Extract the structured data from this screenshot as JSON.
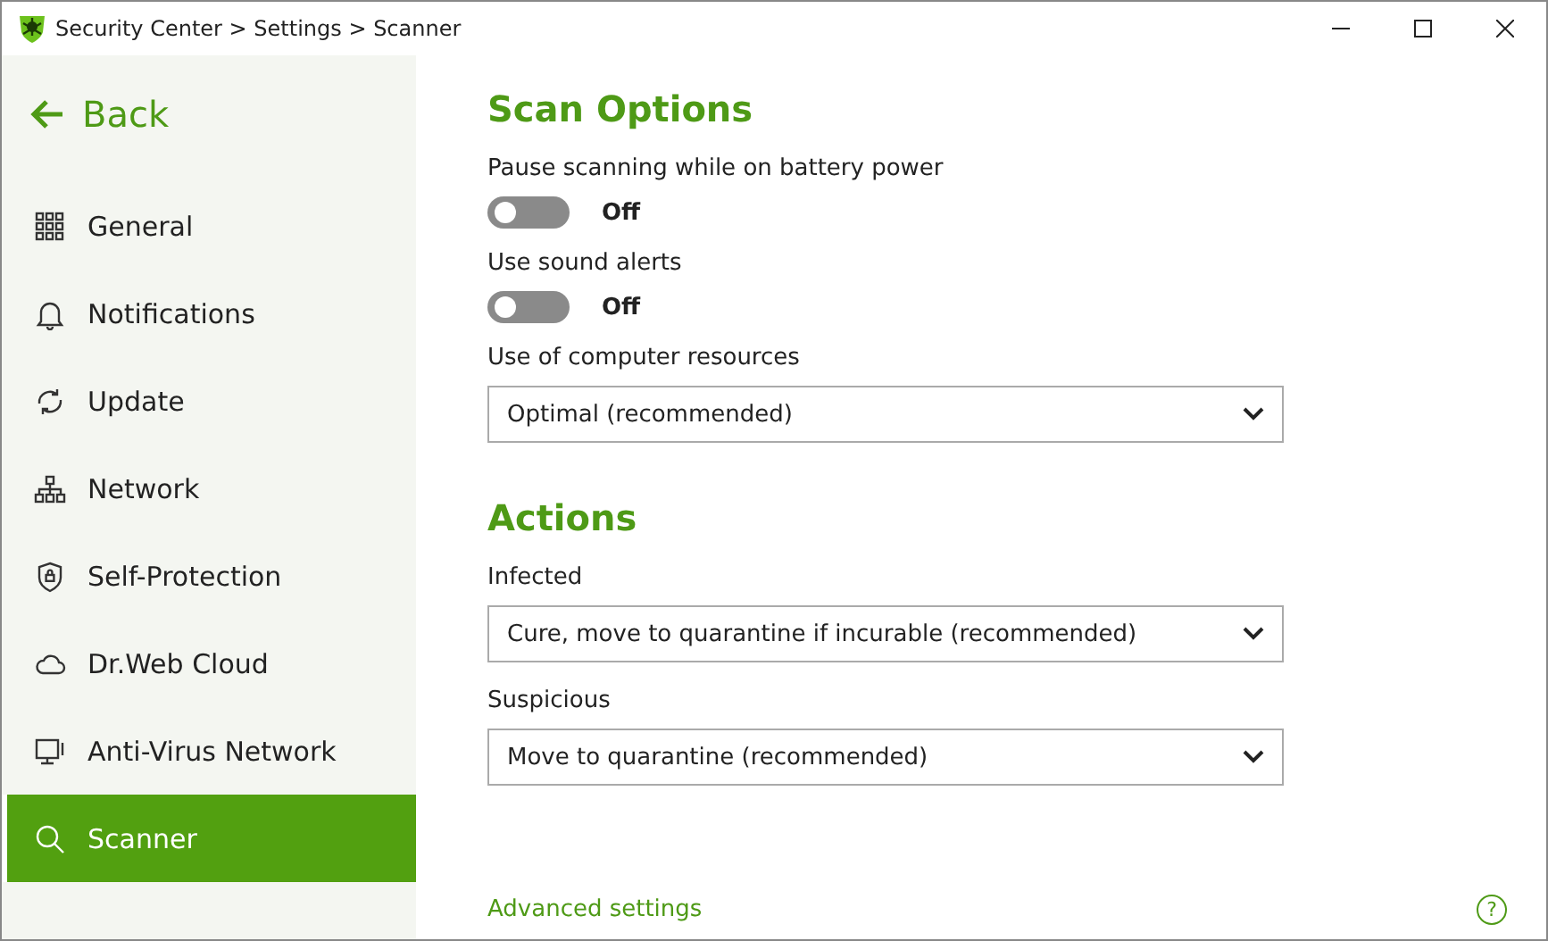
{
  "window": {
    "title": "Security Center > Settings > Scanner"
  },
  "sidebar": {
    "back": "Back",
    "items": [
      {
        "label": "General",
        "kind": "grid",
        "selected": false
      },
      {
        "label": "Notifications",
        "kind": "bell",
        "selected": false
      },
      {
        "label": "Update",
        "kind": "refresh",
        "selected": false
      },
      {
        "label": "Network",
        "kind": "network",
        "selected": false
      },
      {
        "label": "Self-Protection",
        "kind": "shield",
        "selected": false
      },
      {
        "label": "Dr.Web Cloud",
        "kind": "cloud",
        "selected": false
      },
      {
        "label": "Anti-Virus Network",
        "kind": "monitor",
        "selected": false
      },
      {
        "label": "Scanner",
        "kind": "search",
        "selected": true
      }
    ]
  },
  "sections": [
    {
      "title": "Scan Options",
      "settings": [
        {
          "kind": "toggle",
          "label": "Pause scanning while on battery power",
          "on": false,
          "state": "Off"
        },
        {
          "kind": "toggle",
          "label": "Use sound alerts",
          "on": false,
          "state": "Off"
        },
        {
          "kind": "select",
          "label": "Use of computer resources",
          "value": "Optimal (recommended)"
        }
      ]
    },
    {
      "title": "Actions",
      "settings": [
        {
          "kind": "select",
          "label": "Infected",
          "value": "Cure, move to quarantine if incurable (recommended)"
        },
        {
          "kind": "select",
          "label": "Suspicious",
          "value": "Move to quarantine (recommended)"
        }
      ]
    }
  ],
  "footer": {
    "link": "Advanced settings",
    "help": "?"
  }
}
